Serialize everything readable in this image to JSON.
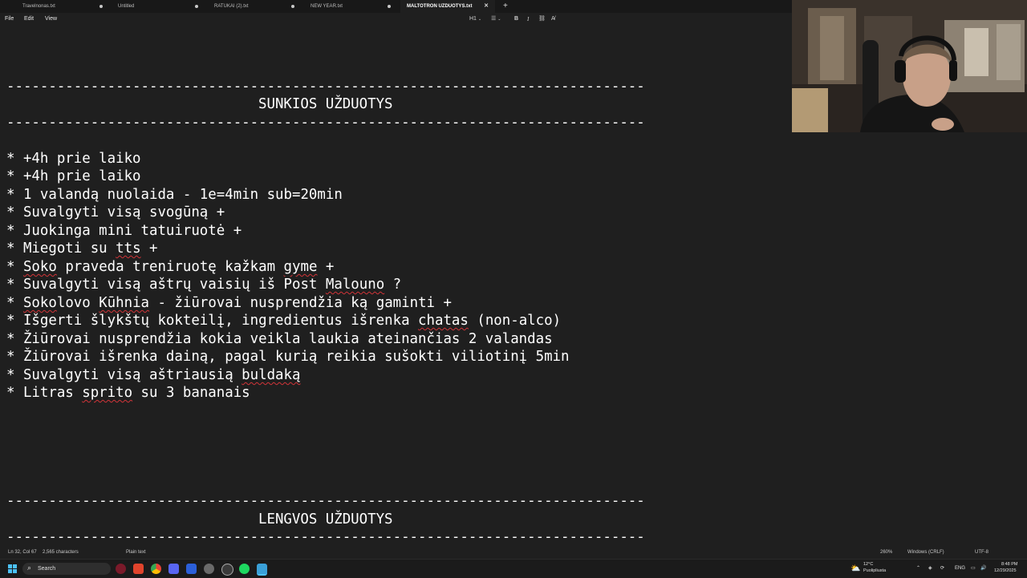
{
  "tabs": [
    {
      "label": "Travelnonas.txt",
      "state": "modified"
    },
    {
      "label": "Untitled",
      "state": "modified"
    },
    {
      "label": "RATUKAI (2).txt",
      "state": "modified"
    },
    {
      "label": "NEW YEAR.txt",
      "state": "modified"
    },
    {
      "label": "MALTOTRON UZDUOTYS.txt",
      "state": "active"
    }
  ],
  "new_tab_label": "+",
  "menu": {
    "file": "File",
    "edit": "Edit",
    "view": "View"
  },
  "toolbar": {
    "heading": "H1",
    "bold": "B",
    "italic": "I"
  },
  "editor": {
    "separator": "----------------------------------------------------------------------------",
    "hard_heading": "SUNKIOS UŽDUOTYS",
    "easy_heading": "LENGVOS UŽDUOTYS",
    "tasks": [
      "* +4h prie laiko",
      "* +4h prie laiko",
      "* 1 valandą nuolaida - 1e=4min sub=20min",
      "* Suvalgyti visą svogūną +",
      "* Juokinga mini tatuiruotė +",
      "* Miegoti su tts +",
      "* Soko praveda treniruotę kažkam gyme +",
      "* Suvalgyti visą aštrų vaisių iš Post Malouno ?",
      "* Sokolovo Kūhnia - žiūrovai nusprendžia ką gaminti +",
      "* Išgerti šlykštų kokteilį, ingredientus išrenka chatas (non-alco)",
      "* Žiūrovai nusprendžia kokia veikla laukia ateinančias 2 valandas",
      "* Žiūrovai išrenka dainą, pagal kurią reikia sušokti viliotinį 5min",
      "* Suvalgyti visą aštriausią buldaką",
      "* Litras sprito su 3 bananais"
    ]
  },
  "status": {
    "position": "Ln 32, Col 67",
    "characters": "2,565 characters",
    "format": "Plain text",
    "zoom": "260%",
    "line_ending": "Windows (CRLF)",
    "encoding": "UTF-8"
  },
  "taskbar": {
    "search_placeholder": "Search",
    "weather_temp": "12°C",
    "weather_desc": "Puolipliusta",
    "language": "ENG",
    "time": "8:48 PM",
    "date": "12/29/2025"
  },
  "icons": {
    "start": "windows-start-icon",
    "search": "search-icon",
    "weather": "cloud-sun-icon"
  },
  "colors": {
    "background": "#1f1f1f",
    "accent": "#4cc2ff",
    "spellcheck": "#d13438"
  }
}
